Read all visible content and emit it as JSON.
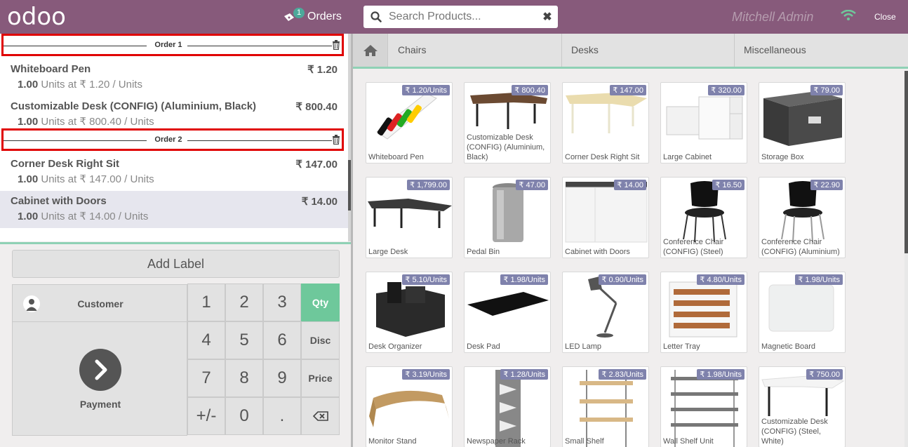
{
  "header": {
    "logo": "odoo",
    "orders_label": "Orders",
    "orders_badge": "1",
    "search_placeholder": "Search Products...",
    "user": "Mitchell Admin",
    "close_label": "Close"
  },
  "orders": [
    {
      "label": "Order 1",
      "lines": [
        {
          "name": "Whiteboard Pen",
          "price": "₹ 1.20",
          "qty": "1.00",
          "unit_text": "Units at ₹ 1.20 / Units"
        },
        {
          "name": "Customizable Desk (CONFIG) (Aluminium, Black)",
          "price": "₹ 800.40",
          "qty": "1.00",
          "unit_text": "Units at ₹ 800.40 / Units"
        }
      ]
    },
    {
      "label": "Order 2",
      "lines": [
        {
          "name": "Corner Desk Right Sit",
          "price": "₹ 147.00",
          "qty": "1.00",
          "unit_text": "Units at ₹ 147.00 / Units"
        },
        {
          "name": "Cabinet with Doors",
          "price": "₹ 14.00",
          "qty": "1.00",
          "unit_text": "Units at ₹ 14.00 / Units"
        }
      ]
    }
  ],
  "controls": {
    "add_label": "Add Label",
    "customer": "Customer",
    "payment": "Payment",
    "keys": [
      "1",
      "2",
      "3",
      "4",
      "5",
      "6",
      "7",
      "8",
      "9",
      "+/-",
      "0",
      "."
    ],
    "modes": [
      "Qty",
      "Disc",
      "Price"
    ]
  },
  "categories": [
    "Chairs",
    "Desks",
    "Miscellaneous"
  ],
  "products": [
    {
      "name": "Whiteboard Pen",
      "price": "₹ 1.20/Units"
    },
    {
      "name": "Customizable Desk (CONFIG) (Aluminium, Black)",
      "price": "₹ 800.40"
    },
    {
      "name": "Corner Desk Right Sit",
      "price": "₹ 147.00"
    },
    {
      "name": "Large Cabinet",
      "price": "₹ 320.00"
    },
    {
      "name": "Storage Box",
      "price": "₹ 79.00"
    },
    {
      "name": "Large Desk",
      "price": "₹ 1,799.00"
    },
    {
      "name": "Pedal Bin",
      "price": "₹ 47.00"
    },
    {
      "name": "Cabinet with Doors",
      "price": "₹ 14.00"
    },
    {
      "name": "Conference Chair (CONFIG) (Steel)",
      "price": "₹ 16.50"
    },
    {
      "name": "Conference Chair (CONFIG) (Aluminium)",
      "price": "₹ 22.90"
    },
    {
      "name": "Desk Organizer",
      "price": "₹ 5.10/Units"
    },
    {
      "name": "Desk Pad",
      "price": "₹ 1.98/Units"
    },
    {
      "name": "LED Lamp",
      "price": "₹ 0.90/Units"
    },
    {
      "name": "Letter Tray",
      "price": "₹ 4.80/Units"
    },
    {
      "name": "Magnetic Board",
      "price": "₹ 1.98/Units"
    },
    {
      "name": "Monitor Stand",
      "price": "₹ 3.19/Units"
    },
    {
      "name": "Newspaper Rack",
      "price": "₹ 1.28/Units"
    },
    {
      "name": "Small Shelf",
      "price": "₹ 2.83/Units"
    },
    {
      "name": "Wall Shelf Unit",
      "price": "₹ 1.98/Units"
    },
    {
      "name": "Customizable Desk (CONFIG) (Steel, White)",
      "price": "₹ 750.00"
    }
  ]
}
